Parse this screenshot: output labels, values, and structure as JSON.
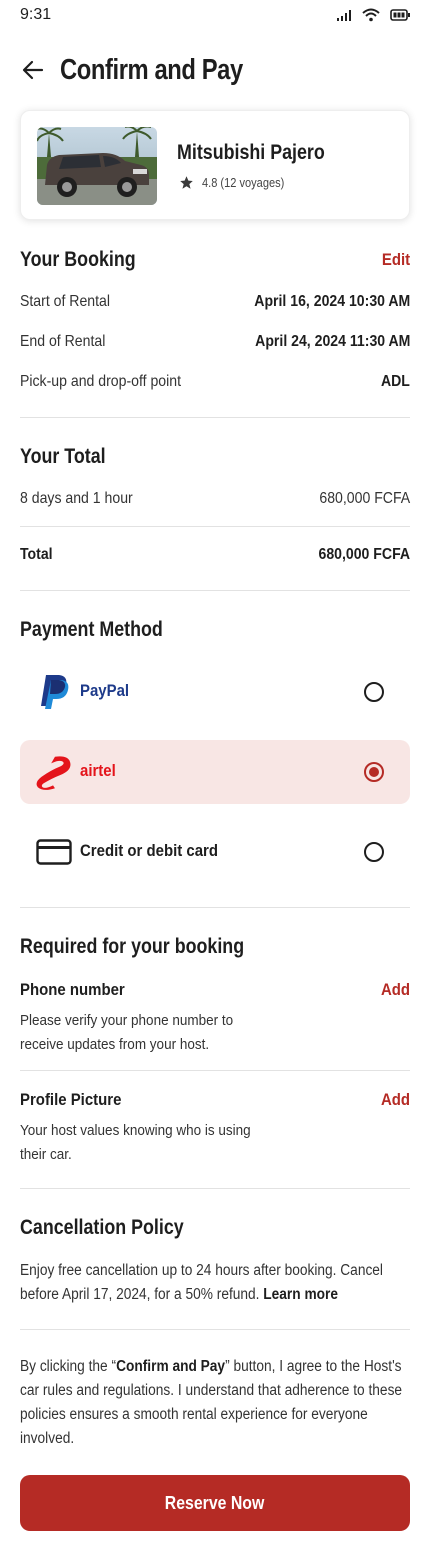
{
  "status_bar": {
    "time": "9:31"
  },
  "header": {
    "title": "Confirm and Pay"
  },
  "car": {
    "name": "Mitsubishi Pajero",
    "rating": "4.8 (12 voyages)"
  },
  "booking": {
    "title": "Your Booking",
    "edit_label": "Edit",
    "rows": [
      {
        "label": "Start of Rental",
        "value": "April 16, 2024 10:30 AM"
      },
      {
        "label": "End of Rental",
        "value": "April 24, 2024 11:30 AM"
      },
      {
        "label": "Pick-up and drop-off point",
        "value": "ADL"
      }
    ]
  },
  "total": {
    "title": "Your Total",
    "duration_label": "8 days and 1 hour",
    "duration_value": "680,000 FCFA",
    "total_label": "Total",
    "total_value": "680,000 FCFA"
  },
  "payment": {
    "title": "Payment Method",
    "options": [
      {
        "label": "PayPal",
        "icon": "paypal-icon",
        "selected": false,
        "color": "#1d3a8a"
      },
      {
        "label": "airtel",
        "icon": "airtel-icon",
        "selected": true,
        "color": "#e4141b"
      },
      {
        "label": "Credit or debit card",
        "icon": "credit-card-icon",
        "selected": false,
        "color": "#1e1e1e"
      }
    ]
  },
  "required": {
    "title": "Required for your booking",
    "items": [
      {
        "title": "Phone number",
        "action": "Add",
        "desc": "Please verify your phone number to receive updates from your host."
      },
      {
        "title": "Profile Picture",
        "action": "Add",
        "desc": "Your host values knowing who is using their car."
      }
    ]
  },
  "cancellation": {
    "title": "Cancellation Policy",
    "text": "Enjoy free cancellation up to 24 hours after booking. Cancel before April 17, 2024, for a 50% refund.",
    "link": "Learn more"
  },
  "agreement": {
    "prefix": "By clicking the “",
    "button_name": "Confirm and Pay",
    "suffix": "” button, I agree to the Host's car rules and regulations. I understand that adherence to these policies ensures a smooth rental experience for everyone involved."
  },
  "reserve_button": "Reserve Now",
  "colors": {
    "accent": "#b52b25",
    "selected_bg": "#f8e6e4",
    "divider": "#e2e2e2"
  }
}
